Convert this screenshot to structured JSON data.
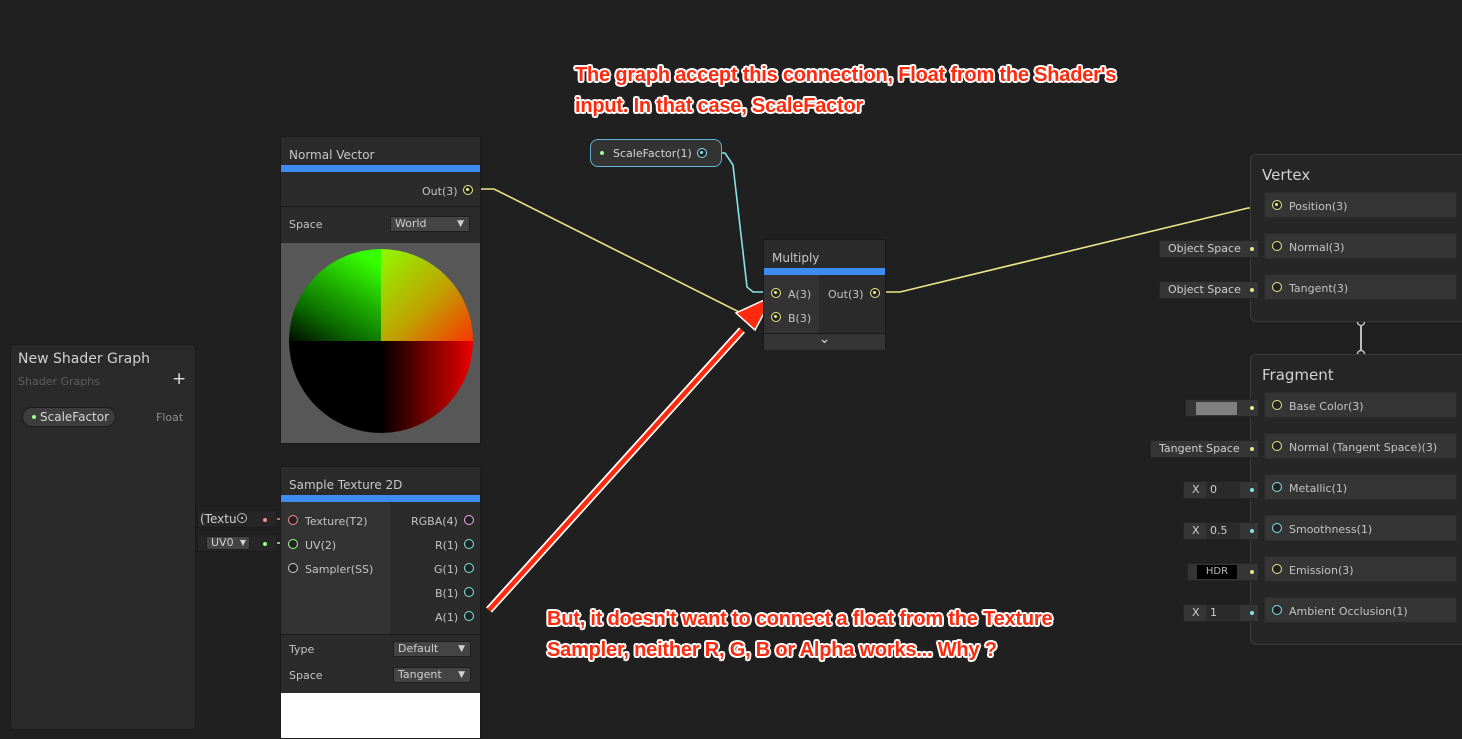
{
  "blackboard": {
    "title": "New Shader Graph",
    "subtitle": "Shader Graphs",
    "add_glyph": "+",
    "property": {
      "name": "ScaleFactor",
      "type": "Float"
    }
  },
  "normal_vector": {
    "title": "Normal Vector",
    "out_label": "Out(3)",
    "space_label": "Space",
    "space_value": "World"
  },
  "sample_texture": {
    "title": "Sample Texture 2D",
    "inputs": [
      "Texture(T2)",
      "UV(2)",
      "Sampler(SS)"
    ],
    "outputs": [
      "RGBA(4)",
      "R(1)",
      "G(1)",
      "B(1)",
      "A(1)"
    ],
    "type_label": "Type",
    "type_value": "Default",
    "space_label": "Space",
    "space_value": "Tangent",
    "texture_field": "(Textu",
    "uv_field": "UV0"
  },
  "scalefactor_node": {
    "label": "ScaleFactor(1)"
  },
  "multiply": {
    "title": "Multiply",
    "in_a": "A(3)",
    "in_b": "B(3)",
    "out": "Out(3)",
    "expand_glyph": "⌄"
  },
  "vertex": {
    "title": "Vertex",
    "slots": [
      {
        "label": "Position(3)",
        "field": ""
      },
      {
        "label": "Normal(3)",
        "field": "Object Space"
      },
      {
        "label": "Tangent(3)",
        "field": "Object Space"
      }
    ]
  },
  "fragment": {
    "title": "Fragment",
    "slots": [
      {
        "label": "Base Color(3)",
        "field": ""
      },
      {
        "label": "Normal (Tangent Space)(3)",
        "field": "Tangent Space"
      },
      {
        "label": "Metallic(1)",
        "field_x": "X",
        "field": "0"
      },
      {
        "label": "Smoothness(1)",
        "field_x": "X",
        "field": "0.5"
      },
      {
        "label": "Emission(3)",
        "field": "HDR"
      },
      {
        "label": "Ambient Occlusion(1)",
        "field_x": "X",
        "field": "1"
      }
    ]
  },
  "annotations": {
    "top_line1": "The graph accept this connection, Float from the Shader's",
    "top_line2": "input. In that case, ScaleFactor",
    "bottom_line1": "But, it doesn't want to connect a float from the Texture",
    "bottom_line2": "Sampler, neither R, G, B or Alpha works... Why ?"
  },
  "colors": {
    "background": "#202020",
    "node_header_accent": "#3f8cf0",
    "vector3_port": "#e8e88a",
    "float_port": "#84e4e7",
    "annotation": "#ff2a0e"
  }
}
